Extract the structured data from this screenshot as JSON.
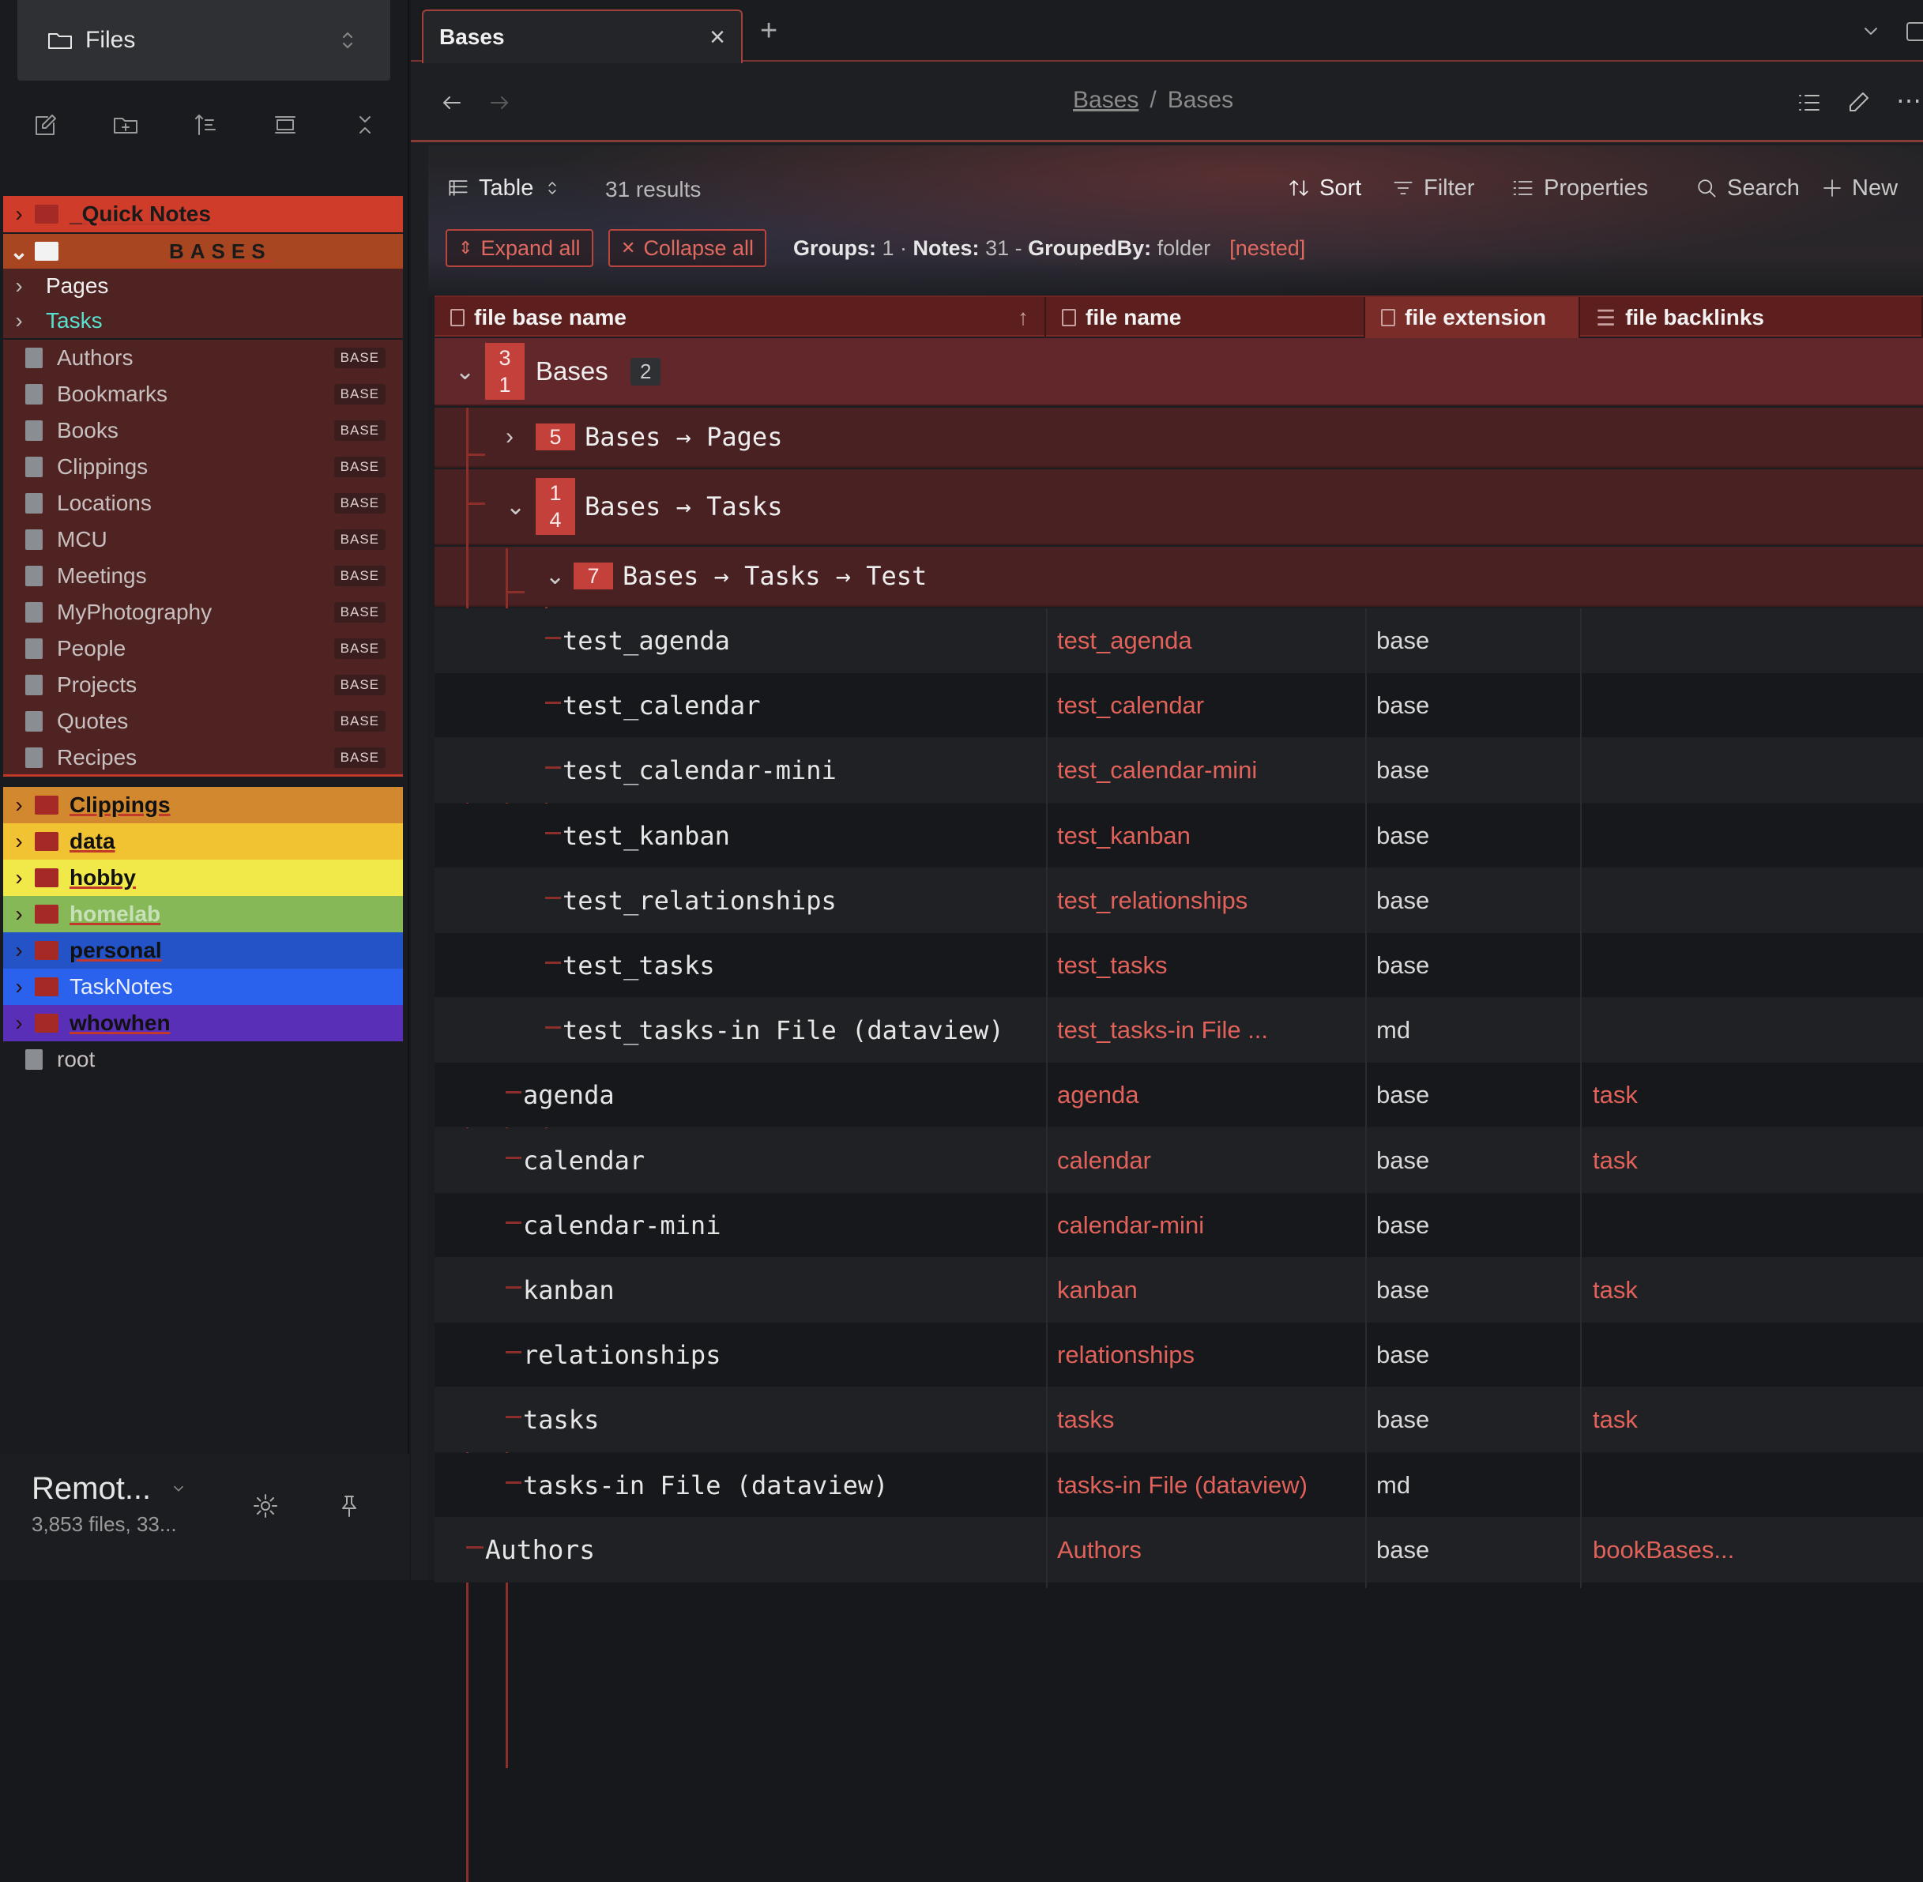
{
  "sidebar": {
    "vault_title": "Files",
    "tree": [
      {
        "label": "_Quick Notes",
        "type": "folder",
        "bg": "#d03c2a",
        "color": "#1a1a1a",
        "underline": true,
        "bold": true,
        "chev": "›"
      },
      {
        "label": "BASES",
        "type": "folder",
        "bg": "#a84622",
        "color": "#1a1a1a",
        "underline": true,
        "bold": true,
        "chev": "⌄",
        "spaced": true
      },
      {
        "label": "Pages",
        "type": "sub",
        "bg": "#4f2322",
        "color": "#f0f0f0",
        "chev": "›"
      },
      {
        "label": "Tasks",
        "type": "sub",
        "bg": "#4f2322",
        "color": "#58e0d0",
        "chev": "›"
      },
      {
        "label": "Authors",
        "type": "file",
        "bg": "#4f2322",
        "badge": "BASE"
      },
      {
        "label": "Bookmarks",
        "type": "file",
        "bg": "#4f2322",
        "badge": "BASE"
      },
      {
        "label": "Books",
        "type": "file",
        "bg": "#4f2322",
        "badge": "BASE"
      },
      {
        "label": "Clippings",
        "type": "file",
        "bg": "#4f2322",
        "badge": "BASE"
      },
      {
        "label": "Locations",
        "type": "file",
        "bg": "#4f2322",
        "badge": "BASE"
      },
      {
        "label": "MCU",
        "type": "file",
        "bg": "#4f2322",
        "badge": "BASE"
      },
      {
        "label": "Meetings",
        "type": "file",
        "bg": "#4f2322",
        "badge": "BASE"
      },
      {
        "label": "MyPhotography",
        "type": "file",
        "bg": "#4f2322",
        "badge": "BASE"
      },
      {
        "label": "People",
        "type": "file",
        "bg": "#4f2322",
        "badge": "BASE"
      },
      {
        "label": "Projects",
        "type": "file",
        "bg": "#4f2322",
        "badge": "BASE"
      },
      {
        "label": "Quotes",
        "type": "file",
        "bg": "#4f2322",
        "badge": "BASE"
      },
      {
        "label": "Recipes",
        "type": "file",
        "bg": "#4f2322",
        "badge": "BASE"
      },
      {
        "label": "Clippings",
        "type": "folder",
        "bg": "#d2882e",
        "color": "#111",
        "underline": true,
        "bold": true,
        "chev": "›"
      },
      {
        "label": "data",
        "type": "folder",
        "bg": "#f1c232",
        "color": "#111",
        "underline": true,
        "bold": true,
        "chev": "›"
      },
      {
        "label": "hobby",
        "type": "folder",
        "bg": "#f1e94a",
        "color": "#111",
        "underline": true,
        "bold": true,
        "chev": "›"
      },
      {
        "label": "homelab",
        "type": "folder",
        "bg": "#86b857",
        "color": "#c8e0b8",
        "underline": true,
        "bold": true,
        "chev": "›"
      },
      {
        "label": "personal",
        "type": "folder",
        "bg": "#2453c8",
        "color": "#111",
        "underline": true,
        "bold": true,
        "chev": "›"
      },
      {
        "label": "TaskNotes",
        "type": "folder",
        "bg": "#2a62ee",
        "color": "#e8eefc",
        "bold": false,
        "chev": "›"
      },
      {
        "label": "whowhen",
        "type": "folder",
        "bg": "#5a2fb8",
        "color": "#111",
        "underline": true,
        "bold": true,
        "chev": "›"
      },
      {
        "label": "root",
        "type": "file",
        "bg": "transparent"
      }
    ],
    "vault_name": "Remot...",
    "vault_stats": "3,853 files, 33..."
  },
  "tab": {
    "title": "Bases",
    "close": "×",
    "new": "+"
  },
  "nav": {
    "crumb_parent": "Bases",
    "crumb_sep": "/",
    "crumb_current": "Bases"
  },
  "toolbar": {
    "view": "Table",
    "results": "31 results",
    "sort": "Sort",
    "filter": "Filter",
    "properties": "Properties",
    "search": "Search",
    "new": "New"
  },
  "groups_bar": {
    "expand_all": "Expand all",
    "collapse_all": "Collapse all",
    "groups_label": "Groups:",
    "groups_value": "1 ·",
    "notes_label": "Notes:",
    "notes_value": "31 -",
    "grouped_label": "GroupedBy:",
    "grouped_value": "folder",
    "nested": "[nested]"
  },
  "columns": [
    "file base name",
    "file name",
    "file extension",
    "file backlinks"
  ],
  "groups": [
    {
      "id": "g0",
      "count": "3\n1",
      "name": "Bases",
      "extra": "2"
    },
    {
      "id": "g1",
      "count": "5",
      "name": "Bases → Pages"
    },
    {
      "id": "g2",
      "count": "1\n4",
      "name": "Bases → Tasks"
    },
    {
      "id": "g3",
      "count": "7",
      "name": "Bases → Tasks → Test"
    }
  ],
  "rows": [
    {
      "base": "test_agenda",
      "name": "test_agenda",
      "ext": "base",
      "links": ""
    },
    {
      "base": "test_calendar",
      "name": "test_calendar",
      "ext": "base",
      "links": ""
    },
    {
      "base": "test_calendar-mini",
      "name": "test_calendar-mini",
      "ext": "base",
      "links": ""
    },
    {
      "base": "test_kanban",
      "name": "test_kanban",
      "ext": "base",
      "links": ""
    },
    {
      "base": "test_relationships",
      "name": "test_relationships",
      "ext": "base",
      "links": ""
    },
    {
      "base": "test_tasks",
      "name": "test_tasks",
      "ext": "base",
      "links": ""
    },
    {
      "base": "test_tasks-in File (dataview)",
      "name": "test_tasks-in File ...",
      "ext": "md",
      "links": ""
    },
    {
      "base": "agenda",
      "name": "agenda",
      "ext": "base",
      "links": "task"
    },
    {
      "base": "calendar",
      "name": "calendar",
      "ext": "base",
      "links": "task"
    },
    {
      "base": "calendar-mini",
      "name": "calendar-mini",
      "ext": "base",
      "links": ""
    },
    {
      "base": "kanban",
      "name": "kanban",
      "ext": "base",
      "links": "task"
    },
    {
      "base": "relationships",
      "name": "relationships",
      "ext": "base",
      "links": ""
    },
    {
      "base": "tasks",
      "name": "tasks",
      "ext": "base",
      "links": "task"
    },
    {
      "base": "tasks-in File (dataview)",
      "name": "tasks-in File (dataview)",
      "ext": "md",
      "links": ""
    },
    {
      "base": "Authors",
      "name": "Authors",
      "ext": "base",
      "links": "bookBases..."
    }
  ]
}
